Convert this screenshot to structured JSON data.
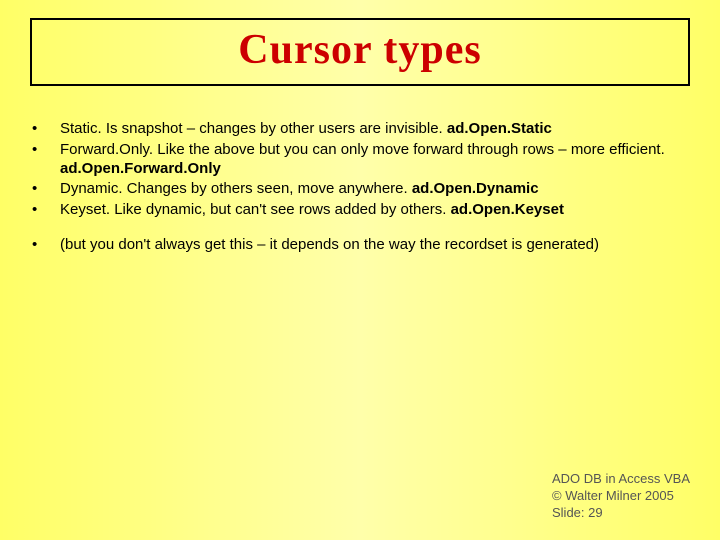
{
  "title": "Cursor types",
  "bullets": {
    "b1_pre": "Static. Is snapshot – changes by other users are invisible. ",
    "b1_code": "ad.Open.Static",
    "b2_pre": "Forward.Only. Like the above but you can only move forward through rows – more efficient. ",
    "b2_code": "ad.Open.Forward.Only",
    "b3_pre": "Dynamic. Changes by others seen, move anywhere. ",
    "b3_code": "ad.Open.Dynamic",
    "b4_pre": "Keyset. Like dynamic, but can't see rows added by others. ",
    "b4_code": "ad.Open.Keyset",
    "b5": "(but you don't always get this – it depends on the way the recordset is generated)"
  },
  "footer": {
    "line1": "ADO DB in Access VBA",
    "line2": "© Walter Milner 2005",
    "line3": "Slide: 29"
  }
}
